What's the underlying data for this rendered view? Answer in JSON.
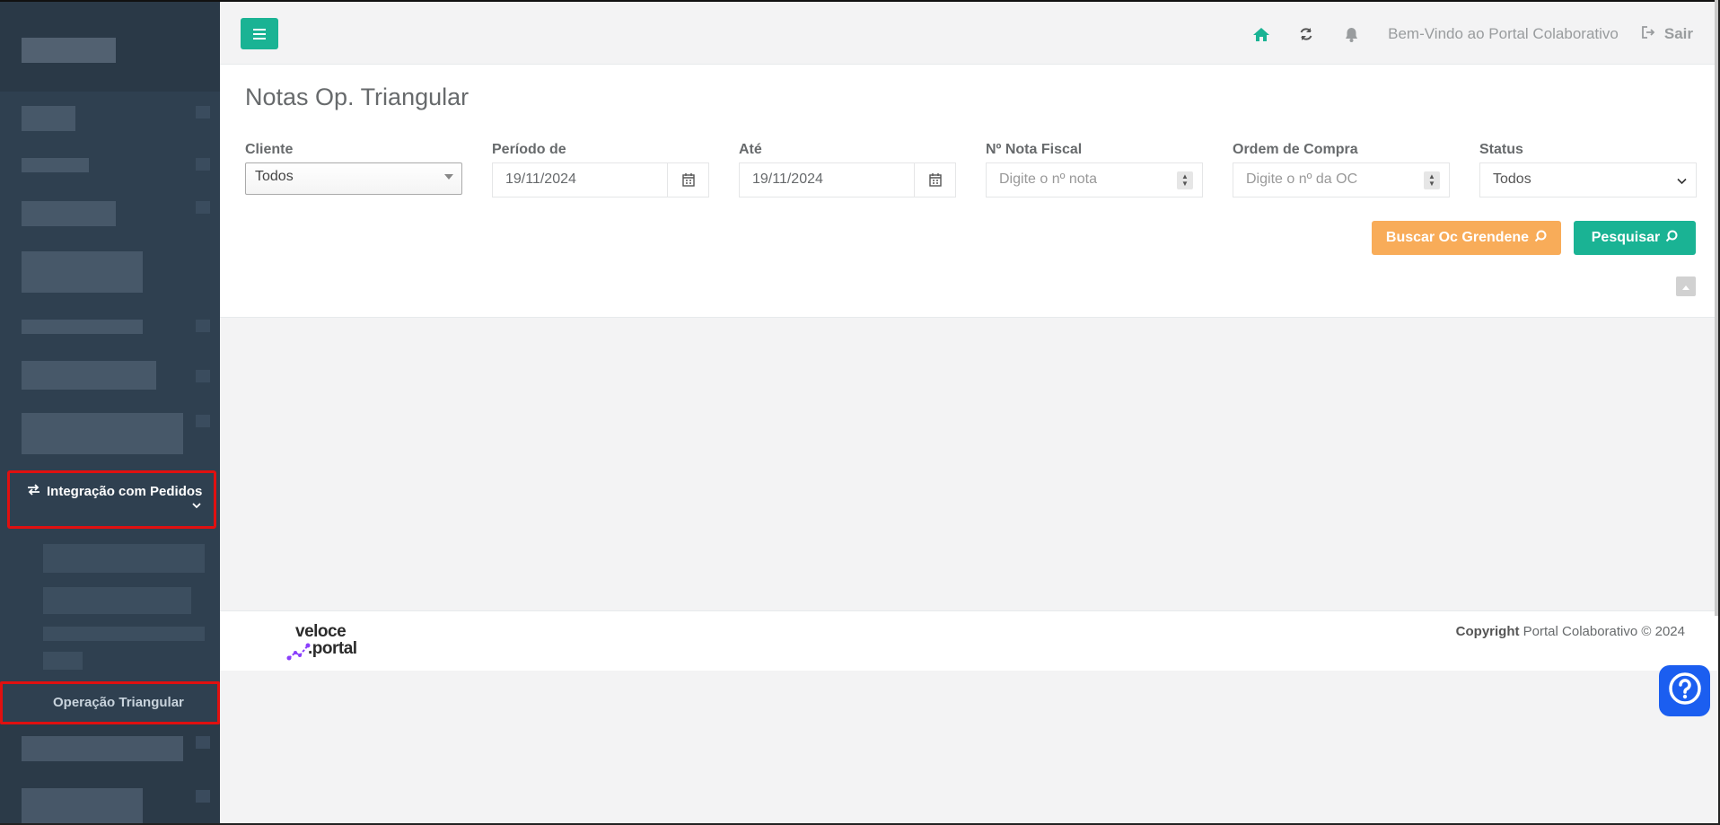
{
  "sidebar": {
    "active_section": {
      "label": "Integração com Pedidos",
      "icon": "exchange-icon"
    },
    "active_item": {
      "label": "Operação Triangular"
    }
  },
  "topbar": {
    "welcome": "Bem-Vindo ao Portal Colaborativo",
    "logout_label": "Sair",
    "icons": [
      "home-icon",
      "refresh-icon",
      "bell-icon",
      "sign-out-icon"
    ],
    "accent": "#1ab394"
  },
  "page": {
    "title": "Notas Op. Triangular"
  },
  "filters": {
    "cliente": {
      "label": "Cliente",
      "value": "Todos"
    },
    "periodo_de": {
      "label": "Período de",
      "value": "19/11/2024"
    },
    "ate": {
      "label": "Até",
      "value": "19/11/2024"
    },
    "nota_fiscal": {
      "label": "Nº Nota Fiscal",
      "placeholder": "Digite o nº nota"
    },
    "ordem_compra": {
      "label": "Ordem de Compra",
      "placeholder": "Digite o nº da OC"
    },
    "status": {
      "label": "Status",
      "value": "Todos"
    }
  },
  "actions": {
    "buscar_label": "Buscar Oc Grendene",
    "pesquisar_label": "Pesquisar",
    "buscar_color": "#f8ac59",
    "pesquisar_color": "#1ab394"
  },
  "footer": {
    "brand_line1": "veloce",
    "brand_line2": ".portal",
    "copyright_bold": "Copyright",
    "copyright_text": " Portal Colaborativo © 2024"
  }
}
